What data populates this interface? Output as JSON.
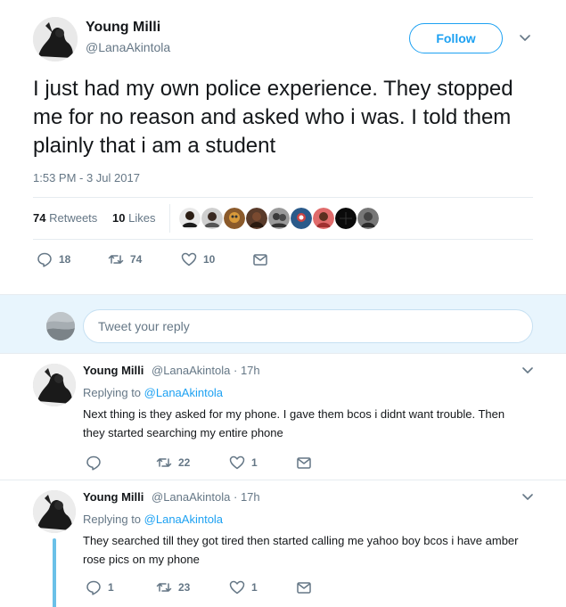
{
  "main_tweet": {
    "name": "Young Milli",
    "handle": "@LanaAkintola",
    "follow_label": "Follow",
    "text": "I just had my own police experience. They stopped me for no reason and asked who i was. I told them plainly that i am a student",
    "timestamp": "1:53 PM - 3 Jul 2017",
    "retweets_count": "74",
    "retweets_label": "Retweets",
    "likes_count": "10",
    "likes_label": "Likes",
    "likers": [
      "liker-avatar",
      "liker-avatar",
      "liker-avatar",
      "liker-avatar",
      "liker-avatar",
      "liker-avatar",
      "liker-avatar",
      "liker-avatar",
      "liker-avatar"
    ],
    "actions": {
      "replies": "18",
      "retweets": "74",
      "likes": "10"
    }
  },
  "reply_composer": {
    "placeholder": "Tweet your reply"
  },
  "replies": [
    {
      "name": "Young Milli",
      "handle": "@LanaAkintola",
      "age": "· 17h",
      "replying_prefix": "Replying to",
      "replying_to": "@LanaAkintola",
      "text": "Next thing is they asked for my phone. I gave them bcos i didnt want trouble. Then they started searching my entire phone",
      "replies": "",
      "retweets": "22",
      "likes": "1"
    },
    {
      "name": "Young Milli",
      "handle": "@LanaAkintola",
      "age": "· 17h",
      "replying_prefix": "Replying to",
      "replying_to": "@LanaAkintola",
      "text": "They searched till they got tired then started calling me yahoo boy bcos i have amber rose pics on my phone",
      "replies": "1",
      "retweets": "23",
      "likes": "1"
    }
  ],
  "colors": {
    "accent": "#1da1f2",
    "muted": "#657786",
    "text": "#14171a",
    "reply_bg": "#e8f5fd",
    "thread_line": "#6ac0e8"
  },
  "icons": [
    "reply-icon",
    "retweet-icon",
    "like-icon",
    "message-icon",
    "chevron-down-icon"
  ]
}
